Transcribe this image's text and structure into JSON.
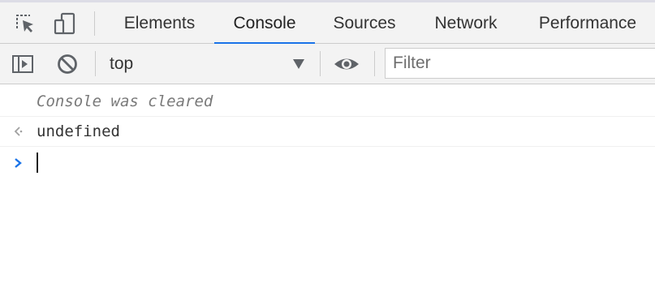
{
  "tabs": [
    {
      "label": "Elements"
    },
    {
      "label": "Console"
    },
    {
      "label": "Sources"
    },
    {
      "label": "Network"
    },
    {
      "label": "Performance"
    }
  ],
  "active_tab": "Console",
  "toolbar": {
    "context": "top",
    "filter_placeholder": "Filter",
    "filter_value": ""
  },
  "console": {
    "messages": [
      {
        "kind": "info",
        "text": "Console was cleared"
      },
      {
        "kind": "result",
        "text": "undefined"
      }
    ],
    "prompt_value": ""
  },
  "icons": {
    "inspect": "inspect-element-icon",
    "device": "device-toolbar-icon",
    "sidebar": "show-sidebar-icon",
    "clear": "clear-console-icon",
    "dropdown": "dropdown-arrow-icon",
    "eye": "live-expression-icon",
    "result": "result-arrow-icon",
    "prompt": "prompt-chevron-icon"
  },
  "colors": {
    "accent": "#1a73e8",
    "prompt_chevron": "#1a73e8",
    "icon": "#5f6368"
  }
}
